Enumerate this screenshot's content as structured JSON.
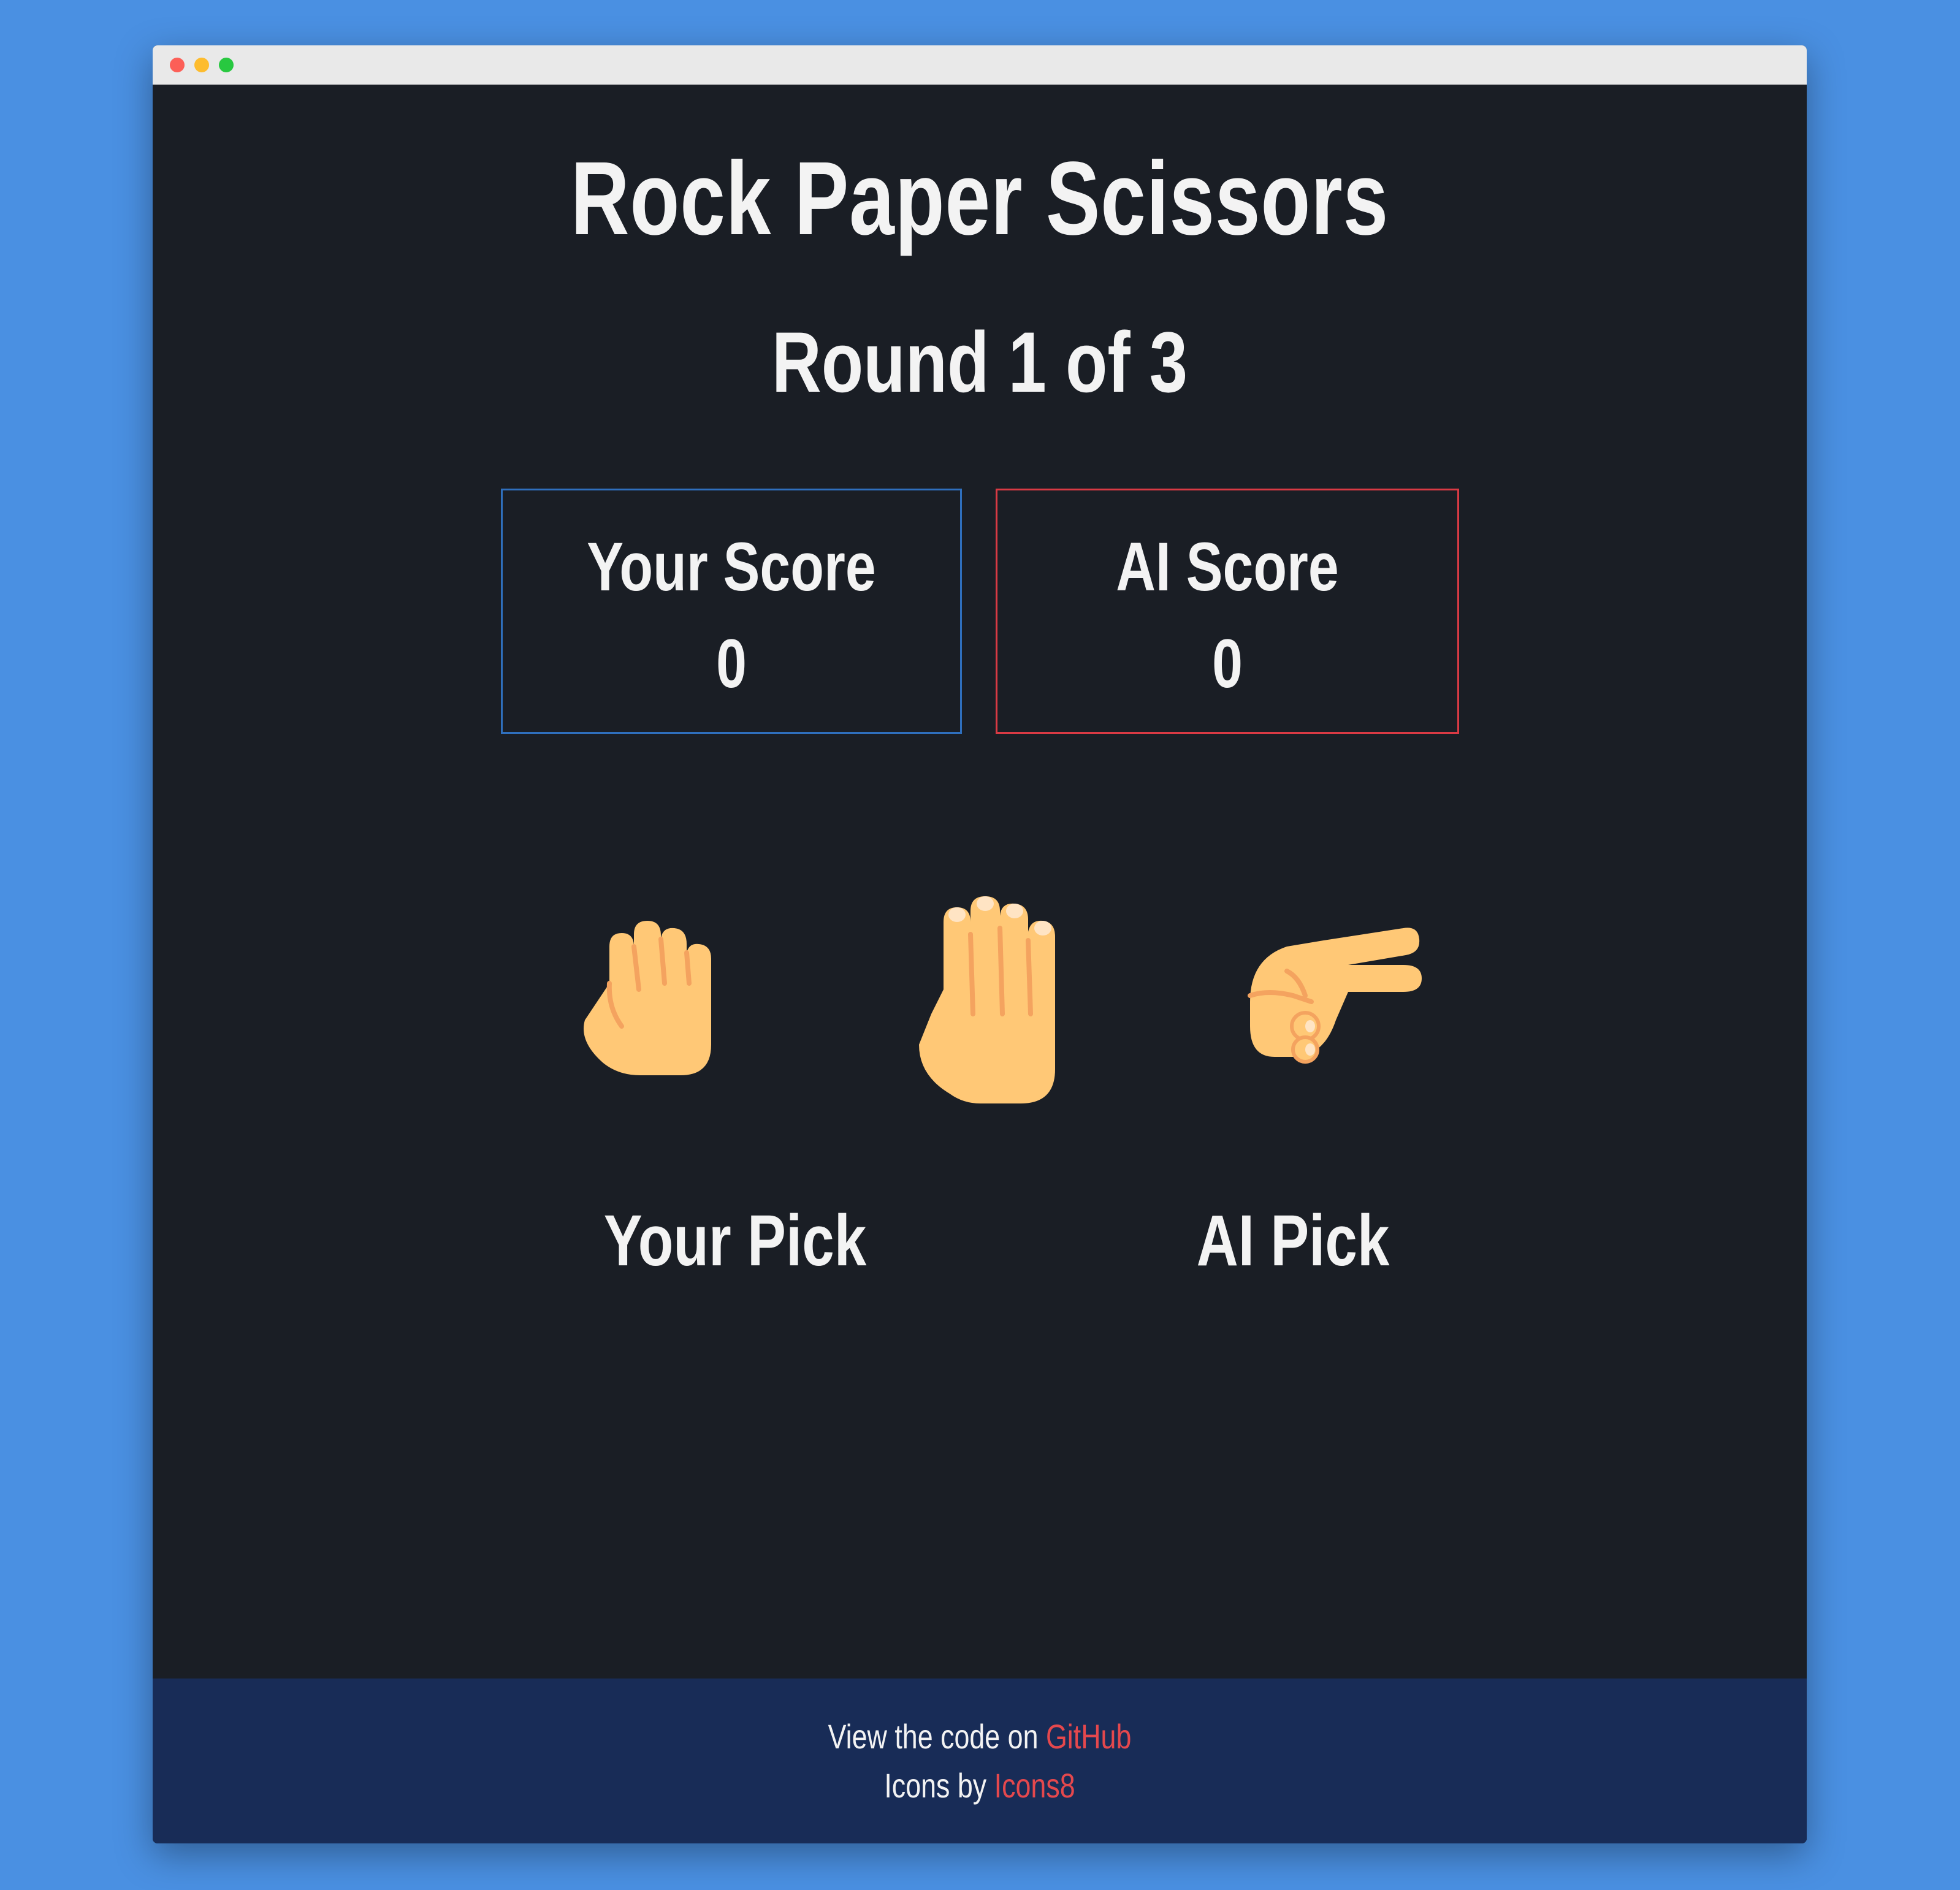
{
  "window": {
    "controls": [
      "close",
      "minimize",
      "maximize"
    ]
  },
  "game": {
    "title": "Rock Paper Scissors",
    "round": "Round 1 of 3"
  },
  "scores": {
    "player": {
      "label": "Your Score",
      "value": "0",
      "border_color": "#2f6fbd"
    },
    "ai": {
      "label": "AI Score",
      "value": "0",
      "border_color": "#d93a44"
    }
  },
  "choices": [
    {
      "name": "rock",
      "icon": "fist-icon"
    },
    {
      "name": "paper",
      "icon": "raised-hand-icon"
    },
    {
      "name": "scissors",
      "icon": "victory-hand-icon"
    }
  ],
  "picks": {
    "player_label": "Your Pick",
    "ai_label": "AI Pick"
  },
  "footer": {
    "code_prefix": "View the code on",
    "code_link": "GitHub",
    "icons_prefix": "Icons by",
    "icons_link": "Icons8",
    "link_color": "#e5484d"
  },
  "colors": {
    "page_background": "#4a90e2",
    "app_background": "#1a1e25",
    "footer_background": "#182c57",
    "text": "#f3f3f3",
    "skin": "#ffc876",
    "skin_shadow": "#f4a35f"
  }
}
